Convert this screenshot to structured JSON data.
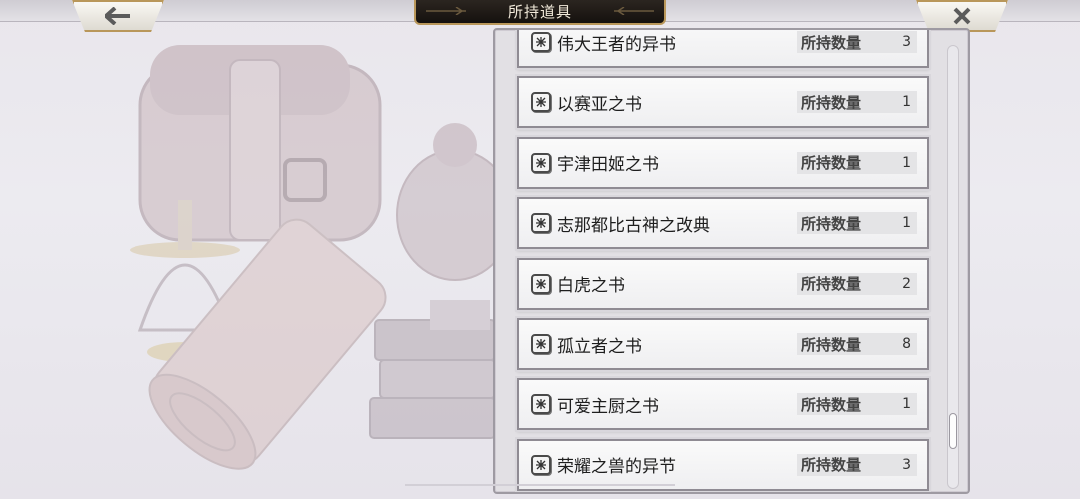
{
  "header": {
    "title": "所持道具"
  },
  "icons": {
    "back": "arrow-left-icon",
    "close": "close-x-icon",
    "item": "book-icon"
  },
  "colors": {
    "title_plate": "#1d1814",
    "gold_trim": "#b9975a",
    "row_bg": "#f5f5f6"
  },
  "items": [
    {
      "name": "伟大王者的异书",
      "qty_label": "所持数量",
      "qty": "3"
    },
    {
      "name": "以赛亚之书",
      "qty_label": "所持数量",
      "qty": "1"
    },
    {
      "name": "宇津田姬之书",
      "qty_label": "所持数量",
      "qty": "1"
    },
    {
      "name": "志那都比古神之改典",
      "qty_label": "所持数量",
      "qty": "1"
    },
    {
      "name": "白虎之书",
      "qty_label": "所持数量",
      "qty": "2"
    },
    {
      "name": "孤立者之书",
      "qty_label": "所持数量",
      "qty": "8"
    },
    {
      "name": "可爱主厨之书",
      "qty_label": "所持数量",
      "qty": "1"
    },
    {
      "name": "荣耀之兽的异节",
      "qty_label": "所持数量",
      "qty": "3"
    }
  ]
}
